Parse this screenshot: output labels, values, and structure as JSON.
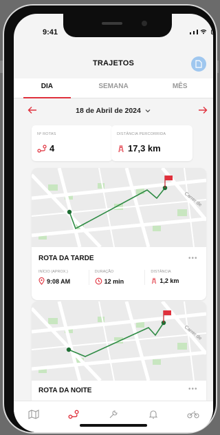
{
  "status": {
    "time": "9:41"
  },
  "header": {
    "title": "TRAJETOS"
  },
  "tabs": [
    {
      "label": "DIA",
      "active": true
    },
    {
      "label": "SEMANA",
      "active": false
    },
    {
      "label": "MÊS",
      "active": false
    }
  ],
  "date": {
    "label": "18 de Abril de 2024"
  },
  "stats": {
    "routes": {
      "label": "Nº ROTAS",
      "value": "4"
    },
    "distance": {
      "label": "DISTÂNCIA PERCORRIDA",
      "value": "17,3 km"
    }
  },
  "routes": [
    {
      "title": "ROTA DA TARDE",
      "map_street_label": "Carrer de",
      "start": {
        "label": "INÍCIO (APROX.)",
        "value": "9:08 AM"
      },
      "duration": {
        "label": "DURAÇÃO",
        "value": "12 min"
      },
      "distance": {
        "label": "DISTÂNCIA",
        "value": "1,2 km"
      }
    },
    {
      "title": "ROTA DA NOITE",
      "map_street_label": "Carrer de"
    }
  ],
  "nav": [
    "map-icon",
    "route-icon",
    "wrench-icon",
    "bell-icon",
    "motorcycle-icon"
  ],
  "colors": {
    "accent": "#e0303c",
    "route_line": "#2e8b44",
    "map_bg": "#ebebeb",
    "park": "#c8e6c0"
  }
}
